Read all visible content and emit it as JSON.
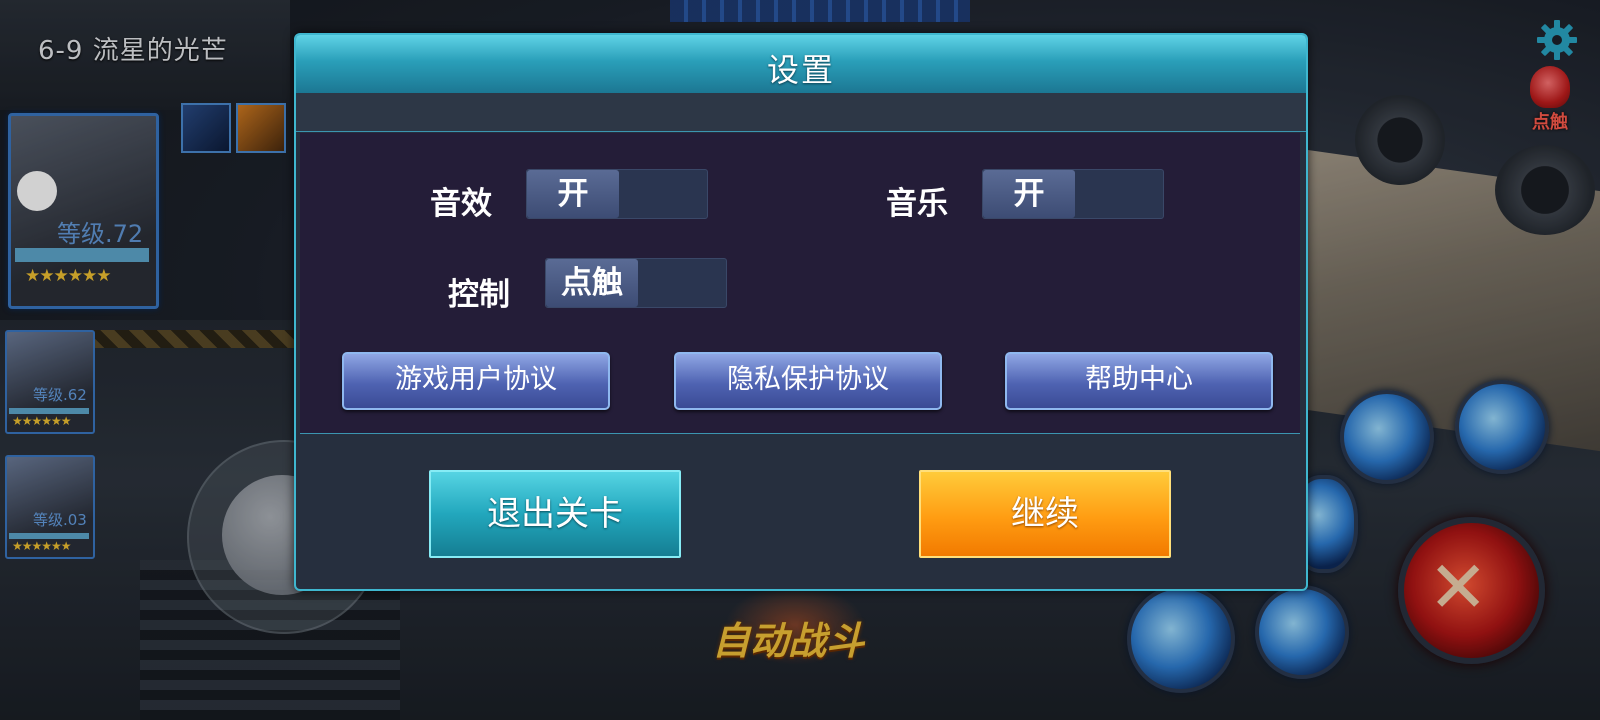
{
  "hud": {
    "level_title": "6-9 流星的光芒",
    "touch_label": "点触",
    "hero": {
      "level": "等级.72",
      "stars": "★★★★★★"
    },
    "allies": [
      {
        "level": "等级.62",
        "stars": "★★★★★★"
      },
      {
        "level": "等级.03",
        "stars": "★★★★★★"
      }
    ],
    "auto_battle": "自动战斗"
  },
  "settings": {
    "title": "设置",
    "sound_effects": {
      "label": "音效",
      "value": "开"
    },
    "music": {
      "label": "音乐",
      "value": "开"
    },
    "control": {
      "label": "控制",
      "value": "点触"
    },
    "links": {
      "user_agreement": "游戏用户协议",
      "privacy": "隐私保护协议",
      "help": "帮助中心"
    },
    "exit_label": "退出关卡",
    "continue_label": "继续"
  },
  "icons": [
    "gear-icon",
    "touch-hand-icon",
    "attack-swords-icon"
  ],
  "colors": {
    "accent": "#3fb7cf",
    "continue": "#ff9c12",
    "exit": "#22a7bd"
  }
}
